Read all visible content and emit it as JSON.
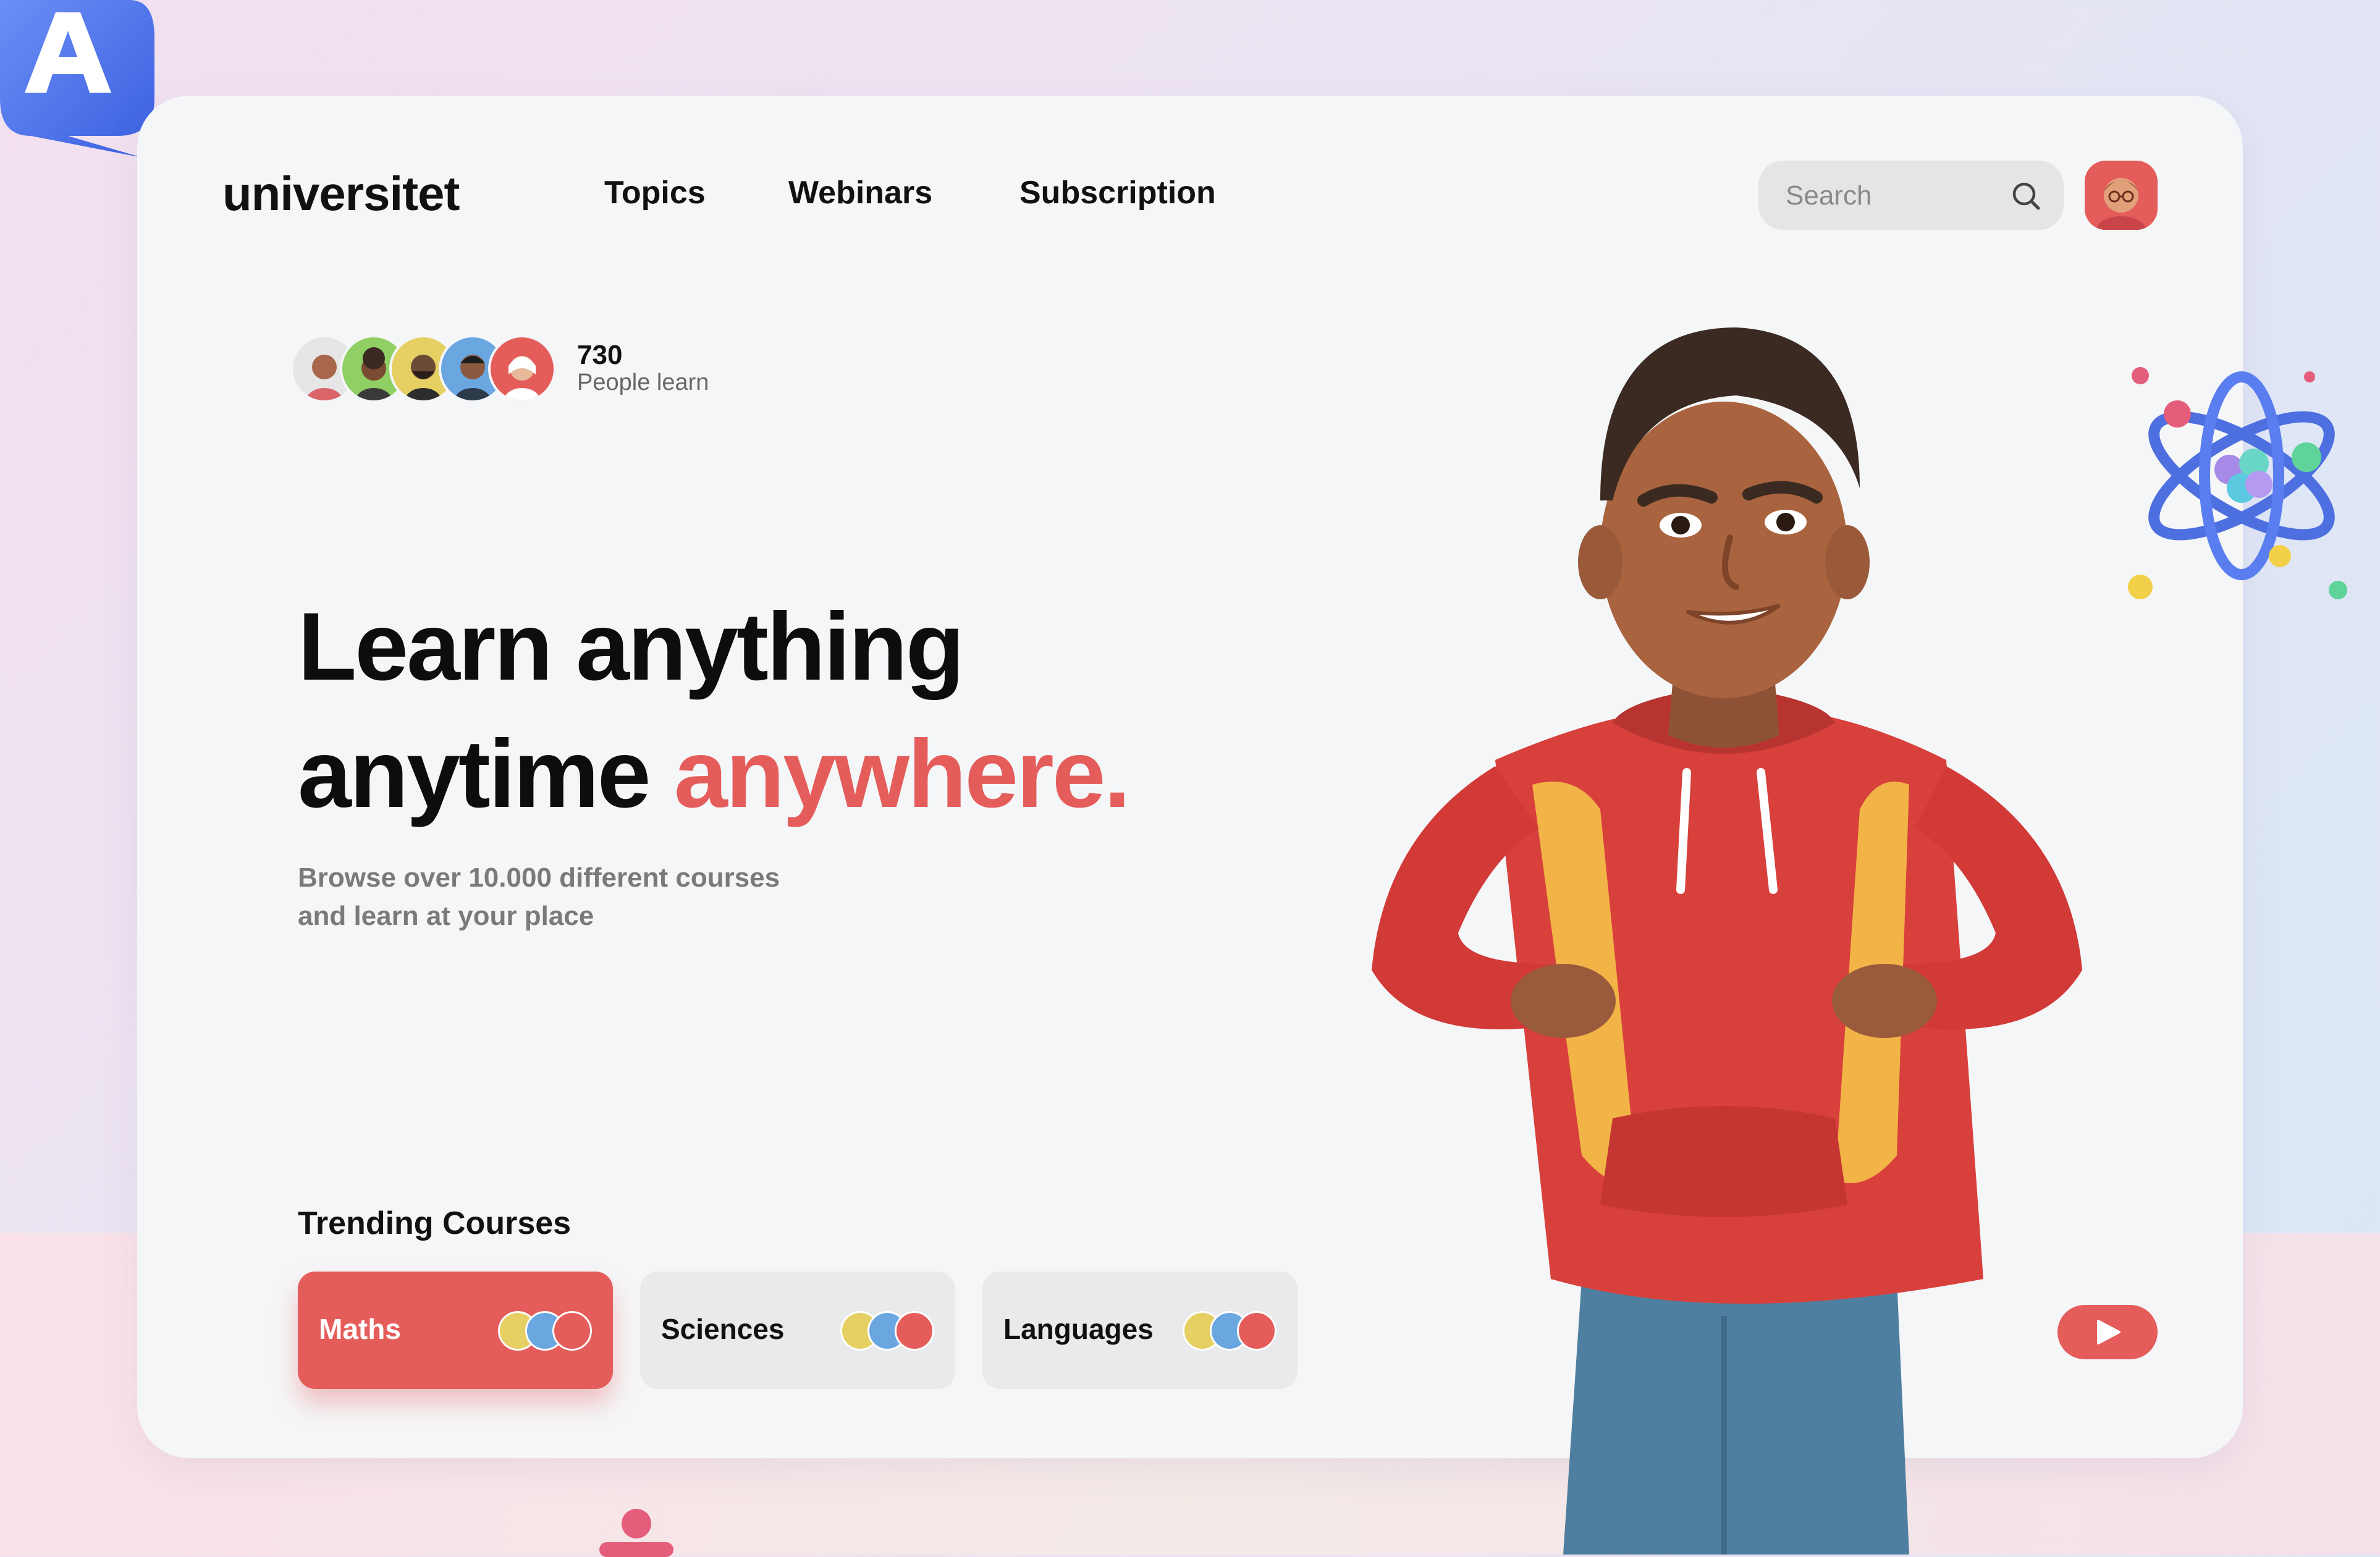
{
  "brand": {
    "logo": "universitet"
  },
  "nav": {
    "topics": "Topics",
    "webinars": "Webinars",
    "subscription": "Subscription"
  },
  "search": {
    "placeholder": "Search"
  },
  "learners": {
    "count": "730",
    "label": "People learn"
  },
  "hero": {
    "line1": "Learn anything",
    "line2_plain": "anytime ",
    "line2_accent": "anywhere.",
    "sub1": "Browse over 10.000 different courses",
    "sub2": "and learn at your place"
  },
  "trending": {
    "title": "Trending Courses",
    "courses": [
      {
        "label": "Maths",
        "active": true
      },
      {
        "label": "Sciences",
        "active": false
      },
      {
        "label": "Languages",
        "active": false
      }
    ]
  },
  "colors": {
    "accent": "#e45d5b",
    "card": "#f5f6f8",
    "pill": "#e9eaeb"
  },
  "icons": {
    "search": "search-icon",
    "play": "play-icon",
    "avatar": "user-avatar"
  }
}
